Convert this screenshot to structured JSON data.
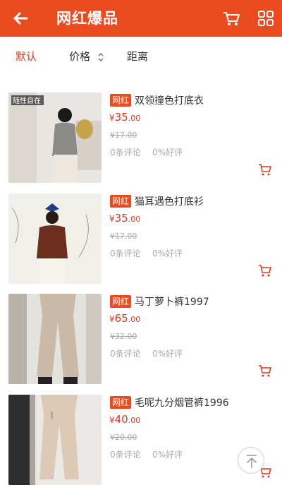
{
  "header": {
    "title": "网红爆品",
    "bg_color": "#ea4c1f",
    "icons": [
      "back-arrow-icon",
      "cart-icon",
      "grid-icon"
    ]
  },
  "sort": {
    "tabs": [
      "默认",
      "价格",
      "距离"
    ],
    "active": "默认",
    "active_color": "#e2361c"
  },
  "products": [
    {
      "badge": "网红",
      "name": "双领撞色打底衣",
      "currency": "¥",
      "price_int": "35",
      "price_dec": ".00",
      "orig_price": "¥17.00",
      "reviews": "0条评论",
      "good_rate": "0%好评",
      "image_caption": "随性自在"
    },
    {
      "badge": "网红",
      "name": "猫耳遇色打底衫",
      "currency": "¥",
      "price_int": "35",
      "price_dec": ".00",
      "orig_price": "¥17.00",
      "reviews": "0条评论",
      "good_rate": "0%好评"
    },
    {
      "badge": "网红",
      "name": "马丁萝卜裤1997",
      "currency": "¥",
      "price_int": "65",
      "price_dec": ".00",
      "orig_price": "¥32.00",
      "reviews": "0条评论",
      "good_rate": "0%好评"
    },
    {
      "badge": "网红",
      "name": "毛呢九分烟管裤1996",
      "currency": "¥",
      "price_int": "40",
      "price_dec": ".00",
      "orig_price": "¥20.00",
      "reviews": "0条评论",
      "good_rate": "0%好评"
    }
  ]
}
